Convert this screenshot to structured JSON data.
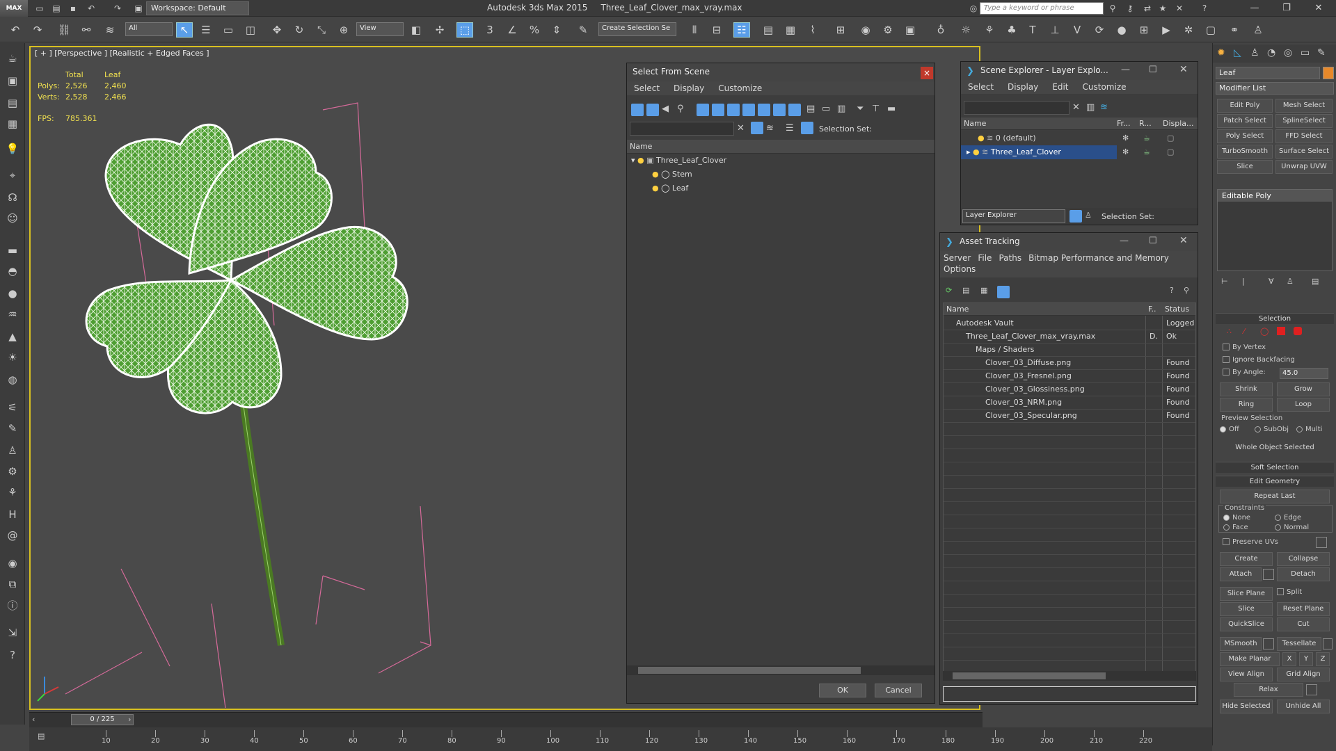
{
  "titlebar": {
    "logo": "MAX",
    "workspace": "Workspace: Default",
    "app_title": "Autodesk 3ds Max 2015",
    "file_title": "Three_Leaf_Clover_max_vray.max",
    "search_placeholder": "Type a keyword or phrase"
  },
  "toolbar": {
    "filter_dropdown": "All",
    "view_dropdown": "View",
    "selection_set_dropdown": "Create Selection Se"
  },
  "viewport": {
    "label": "[ + ] [Perspective ] [Realistic + Edged Faces ]",
    "stats_header_total": "Total",
    "stats_header_leaf": "Leaf",
    "polys_label": "Polys:",
    "polys_total": "2,526",
    "polys_leaf": "2,460",
    "verts_label": "Verts:",
    "verts_total": "2,528",
    "verts_leaf": "2,466",
    "fps_label": "FPS:",
    "fps_value": "785.361"
  },
  "select_from_scene": {
    "title": "Select From Scene",
    "menu": [
      "Select",
      "Display",
      "Customize"
    ],
    "selection_set_label": "Selection Set:",
    "column_name": "Name",
    "items": [
      {
        "label": "Three_Leaf_Clover",
        "level": 0
      },
      {
        "label": "Stem",
        "level": 1
      },
      {
        "label": "Leaf",
        "level": 1
      }
    ],
    "ok": "OK",
    "cancel": "Cancel"
  },
  "scene_explorer": {
    "title": "Scene Explorer - Layer Explo...",
    "menu": [
      "Select",
      "Display",
      "Edit",
      "Customize"
    ],
    "columns": [
      "Name",
      "Fr...",
      "R...",
      "Displa..."
    ],
    "rows": [
      "0 (default)",
      "Three_Leaf_Clover"
    ],
    "footer_dropdown": "Layer Explorer",
    "selection_set_label": "Selection Set:"
  },
  "asset_tracking": {
    "title": "Asset Tracking",
    "menu": [
      "Server",
      "File",
      "Paths",
      "Bitmap Performance and Memory",
      "Options"
    ],
    "columns": [
      "Name",
      "F..",
      "Status"
    ],
    "rows": [
      {
        "name": "Autodesk Vault",
        "f": "",
        "status": "Logged",
        "indent": 0
      },
      {
        "name": "Three_Leaf_Clover_max_vray.max",
        "f": "D.",
        "status": "Ok",
        "indent": 1
      },
      {
        "name": "Maps / Shaders",
        "f": "",
        "status": "",
        "indent": 2
      },
      {
        "name": "Clover_03_Diffuse.png",
        "f": "",
        "status": "Found",
        "indent": 3
      },
      {
        "name": "Clover_03_Fresnel.png",
        "f": "",
        "status": "Found",
        "indent": 3
      },
      {
        "name": "Clover_03_Glossiness.png",
        "f": "",
        "status": "Found",
        "indent": 3
      },
      {
        "name": "Clover_03_NRM.png",
        "f": "",
        "status": "Found",
        "indent": 3
      },
      {
        "name": "Clover_03_Specular.png",
        "f": "",
        "status": "Found",
        "indent": 3
      }
    ]
  },
  "command_panel": {
    "object_name": "Leaf",
    "modifier_list": "Modifier List",
    "modifier_buttons": [
      "Edit Poly",
      "Mesh Select",
      "Patch Select",
      "SplineSelect",
      "Poly Select",
      "FFD Select",
      "TurboSmooth",
      "Surface Select",
      "Slice",
      "Unwrap UVW"
    ],
    "stack_item": "Editable Poly",
    "selection_title": "Selection",
    "by_vertex": "By Vertex",
    "ignore_backfacing": "Ignore Backfacing",
    "by_angle": "By Angle:",
    "angle_value": "45.0",
    "shrink": "Shrink",
    "grow": "Grow",
    "ring": "Ring",
    "loop": "Loop",
    "preview_selection": "Preview Selection",
    "preview_off": "Off",
    "preview_subobj": "SubObj",
    "preview_multi": "Multi",
    "whole_object": "Whole Object Selected",
    "soft_selection": "Soft Selection",
    "edit_geometry": "Edit Geometry",
    "repeat_last": "Repeat Last",
    "constraints": "Constraints",
    "c_none": "None",
    "c_edge": "Edge",
    "c_face": "Face",
    "c_normal": "Normal",
    "preserve_uvs": "Preserve UVs",
    "create": "Create",
    "collapse": "Collapse",
    "attach": "Attach",
    "detach": "Detach",
    "slice_plane": "Slice Plane",
    "split": "Split",
    "slice": "Slice",
    "reset_plane": "Reset Plane",
    "quickslice": "QuickSlice",
    "cut": "Cut",
    "msmooth": "MSmooth",
    "tessellate": "Tessellate",
    "make_planar": "Make Planar",
    "x": "X",
    "y": "Y",
    "z": "Z",
    "view_align": "View Align",
    "grid_align": "Grid Align",
    "relax": "Relax",
    "hide_selected": "Hide Selected",
    "unhide_all": "Unhide All"
  },
  "timeline": {
    "frame_counter": "0 / 225",
    "ticks": [
      "10",
      "20",
      "30",
      "40",
      "50",
      "60",
      "70",
      "80",
      "90",
      "100",
      "110",
      "120",
      "130",
      "140",
      "150",
      "160",
      "170",
      "180",
      "190",
      "200",
      "210",
      "220"
    ]
  },
  "colors": {
    "accent_blue": "#2a4f8a",
    "viewport_border": "#d8c020",
    "leaf_green": "#5cae3a",
    "stats_yellow": "#f0e050"
  }
}
